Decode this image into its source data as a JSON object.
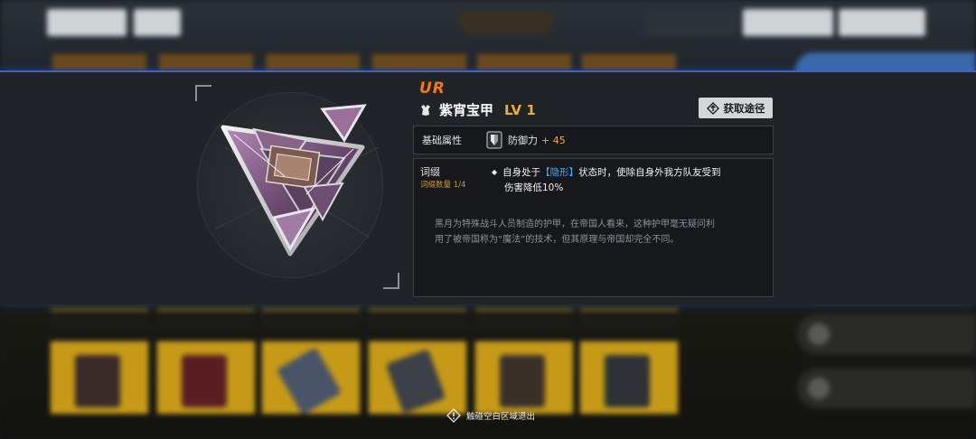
{
  "item": {
    "rarity": "UR",
    "name": "紫宵宝甲",
    "level": "LV 1"
  },
  "source_button": {
    "label": "获取途径",
    "icon": "upload-icon"
  },
  "base_stats": {
    "label": "基础属性",
    "stat_name": "防御力",
    "stat_value": "+ 45",
    "icon": "shield-icon"
  },
  "affix": {
    "label": "词缀",
    "count_label": "词缀数量 1/4",
    "text_prefix": "自身处于",
    "keyword": "【隐形】",
    "text_middle": "状态时，使除自身外我方队友受到",
    "text_line2": "伤害降低10%"
  },
  "lore": {
    "line1": "黑月为特殊战斗人员制造的护甲，在帝国人看来，这种护甲毫无疑问利",
    "line2": "用了被帝国称为“魔法”的技术，但其原理与帝国却完全不同。"
  },
  "hint": {
    "text": "触碰空白区域退出",
    "icon": "warning-diamond-icon"
  },
  "colors": {
    "rarity": "#f07a1a",
    "level": "#e8b03a",
    "keyword": "#4aa8ff",
    "accent_line": "#3b63c8",
    "card_gold": "#c69a17"
  }
}
